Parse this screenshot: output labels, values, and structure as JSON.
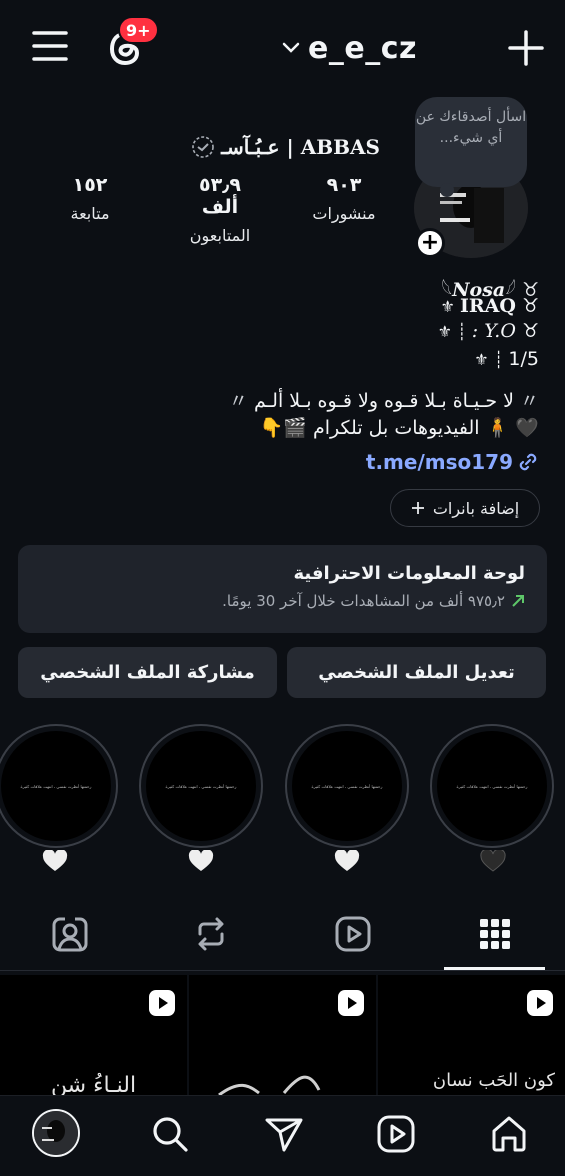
{
  "header": {
    "username": "e_e_cz",
    "notification_badge": "9+"
  },
  "note": {
    "text": "اسأل أصدقاءك عن أي شيء..."
  },
  "profile": {
    "full_name": "عـبُـآسـ | ABBAS",
    "stats": [
      {
        "value": "٩٠٣",
        "label": "منشورات"
      },
      {
        "value": "٥٣٫٩ ألف",
        "label": "المتابعون"
      },
      {
        "value": "١٥٢",
        "label": "متابعة"
      }
    ],
    "bio": {
      "line1": "Nosa",
      "line2": "IRAQ",
      "line3": ": Y.O",
      "line4": "1/5",
      "line5": "لا حـيـاة بـلا قـوه ولا قـوه بـلا ألـم",
      "line6": "الفيديوهات بل تلكرام"
    },
    "link": "t.me/mso179"
  },
  "banners_button": "إضافة بانرات",
  "dashboard": {
    "title": "لوحة المعلومات الاحترافية",
    "subtitle": "٩٧٥٫٢ ألف من المشاهدات خلال آخر 30 يومًا.",
    "trend_color": "#5ec769"
  },
  "buttons": {
    "edit_profile": "تعديل الملف الشخصي",
    "share_profile": "مشاركة الملف الشخصي"
  },
  "highlights": [
    {
      "text": "رحمتها أنظرت نفسي ، انتهت علاقات كثيرة",
      "heart": "black-heart"
    },
    {
      "text": "رحمتها أنظرت نفسي ، انتهت علاقات كثيرة",
      "heart": "white-heart"
    },
    {
      "text": "رحمتها أنظرت نفسي ، انتهت علاقات كثيرة",
      "heart": "white-heart"
    },
    {
      "text": "رحمتها أنظرت نفسي ، انتهت علاقات كثيرة",
      "heart": "white-heart"
    }
  ],
  "tabs": [
    "grid-icon",
    "reels-icon",
    "reposts-icon",
    "tagged-icon"
  ],
  "grid": [
    {
      "caption": "كون الحَب نسان"
    },
    {
      "caption": ""
    },
    {
      "caption": "النـاءُ شن"
    }
  ],
  "colors": {
    "background": "#0c0f14",
    "card": "#1f232b",
    "button": "#262a32",
    "link": "#8aa9ff",
    "badge": "#ff3040"
  }
}
